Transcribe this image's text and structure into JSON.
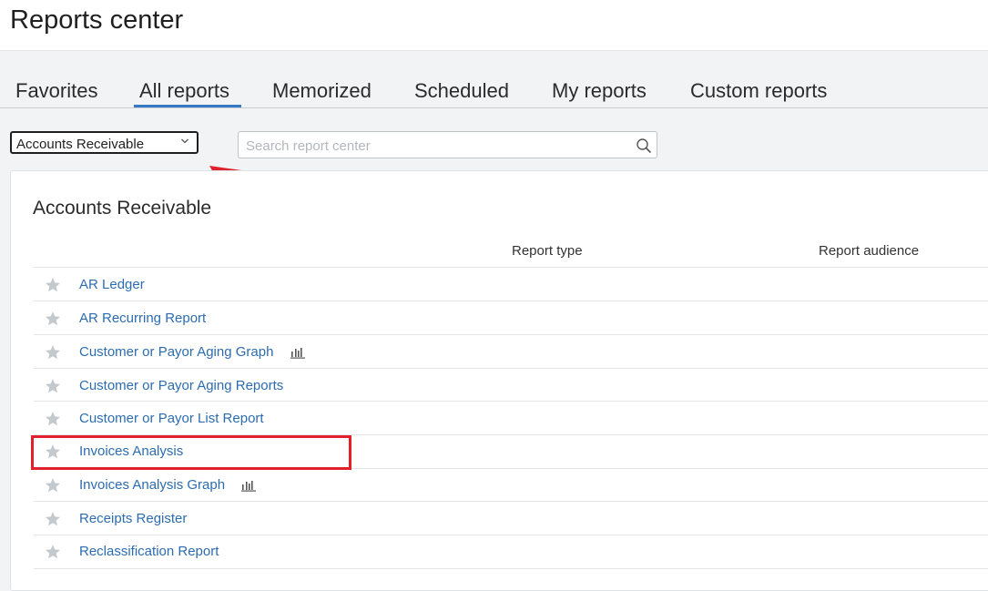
{
  "page_title": "Reports center",
  "tabs": [
    {
      "label": "Favorites"
    },
    {
      "label": "All reports",
      "active": true
    },
    {
      "label": "Memorized"
    },
    {
      "label": "Scheduled"
    },
    {
      "label": "My reports"
    },
    {
      "label": "Custom reports"
    }
  ],
  "category_select": {
    "value": "Accounts Receivable",
    "icon": "chevron-down-icon"
  },
  "search": {
    "placeholder": "Search report center",
    "value": "",
    "icon": "search-icon"
  },
  "section": {
    "title": "Accounts Receivable",
    "columns": {
      "report_type": "Report type",
      "report_audience": "Report audience"
    },
    "reports": [
      {
        "name": "AR Ledger",
        "graph": false
      },
      {
        "name": "AR Recurring Report",
        "graph": false
      },
      {
        "name": "Customer or Payor Aging Graph",
        "graph": true
      },
      {
        "name": "Customer or Payor Aging Reports",
        "graph": false
      },
      {
        "name": "Customer or Payor List Report",
        "graph": false
      },
      {
        "name": "Invoices Analysis",
        "graph": false,
        "highlighted": true
      },
      {
        "name": "Invoices Analysis Graph",
        "graph": true
      },
      {
        "name": "Receipts Register",
        "graph": false
      },
      {
        "name": "Reclassification Report",
        "graph": false
      }
    ]
  },
  "colors": {
    "link": "#2c6cb0",
    "tab_underline": "#3578c6",
    "star": "#c4c9ce",
    "annotation_red": "#e0202a"
  }
}
